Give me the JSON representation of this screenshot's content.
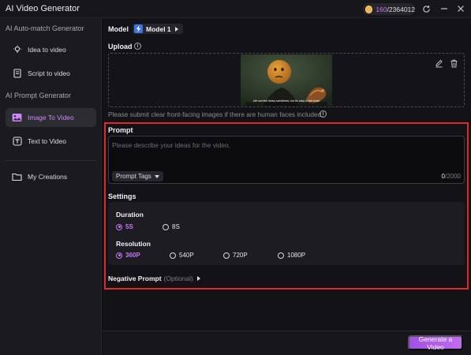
{
  "app": {
    "title": "AI Video Generator"
  },
  "credits": {
    "used": "160",
    "total": "/2364012"
  },
  "sidebar": {
    "sections": [
      "AI Auto-match Generator",
      "AI Prompt Generator"
    ],
    "items": [
      {
        "label": "Idea to video",
        "icon": "lightbulb-icon"
      },
      {
        "label": "Script to video",
        "icon": "document-icon"
      },
      {
        "label": "Image To Video",
        "icon": "image-icon",
        "active": true
      },
      {
        "label": "Text to Video",
        "icon": "text-icon"
      },
      {
        "label": "My Creations",
        "icon": "folder-icon"
      }
    ]
  },
  "model": {
    "label": "Model",
    "value": "Model 1"
  },
  "upload": {
    "label": "Upload",
    "caption": "Life can feel heavy sometimes, but it's okay to feel down",
    "hint": "Please submit clear front-facing images if there are human faces included."
  },
  "prompt": {
    "label": "Prompt",
    "placeholder": "Please describe your ideas for the video.",
    "tags_label": "Prompt Tags",
    "count": "0",
    "max": "/2000"
  },
  "settings": {
    "label": "Settings",
    "duration": {
      "label": "Duration",
      "options": [
        "5S",
        "8S"
      ],
      "selected": "5S"
    },
    "resolution": {
      "label": "Resolution",
      "options": [
        "360P",
        "540P",
        "720P",
        "1080P"
      ],
      "selected": "360P"
    }
  },
  "negative_prompt": {
    "label": "Negative Prompt",
    "optional": "(Optional)"
  },
  "actions": {
    "generate": "Generate a Video"
  },
  "colors": {
    "accent": "#c57af0",
    "highlight": "#e02a2a",
    "brand_blue": "#3a74e8"
  }
}
